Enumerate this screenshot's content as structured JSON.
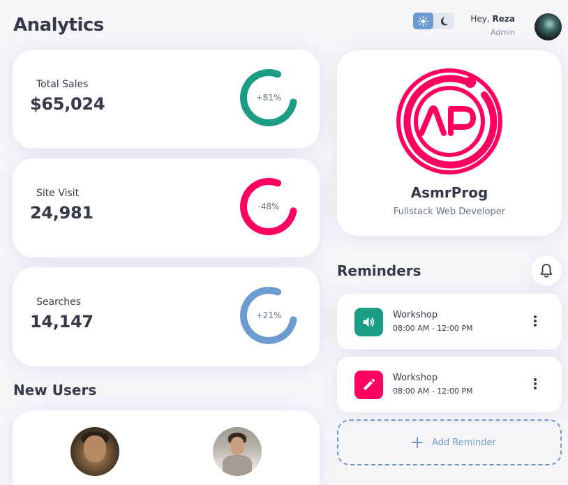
{
  "header": {
    "title": "Analytics",
    "greeting_prefix": "Hey, ",
    "user_name": "Reza",
    "user_role": "Admin"
  },
  "stats": [
    {
      "label": "Total Sales",
      "value": "$65,024",
      "percent_label": "+81%",
      "percent": 81,
      "color": "#1b9c85"
    },
    {
      "label": "Site Visit",
      "value": "24,981",
      "percent_label": "-48%",
      "percent": 48,
      "color": "#ff0060"
    },
    {
      "label": "Searches",
      "value": "14,147",
      "percent_label": "+21%",
      "percent": 21,
      "color": "#6c9bcf"
    }
  ],
  "profile": {
    "name": "AsmrProg",
    "subtitle": "Fullstack Web Developer",
    "logo_text": "AP",
    "brand_color": "#ff0060"
  },
  "reminders": {
    "title": "Reminders",
    "items": [
      {
        "title": "Workshop",
        "time": "08:00 AM - 12:00 PM",
        "icon": "volume-icon",
        "color": "#1b9c85"
      },
      {
        "title": "Workshop",
        "time": "08:00 AM - 12:00 PM",
        "icon": "edit-icon",
        "color": "#ff0060"
      }
    ],
    "add_label": "Add Reminder"
  },
  "new_users": {
    "title": "New Users"
  },
  "colors": {
    "primary": "#6c9bcf",
    "success": "#1b9c85",
    "danger": "#ff0060",
    "background": "#f6f6f9"
  }
}
